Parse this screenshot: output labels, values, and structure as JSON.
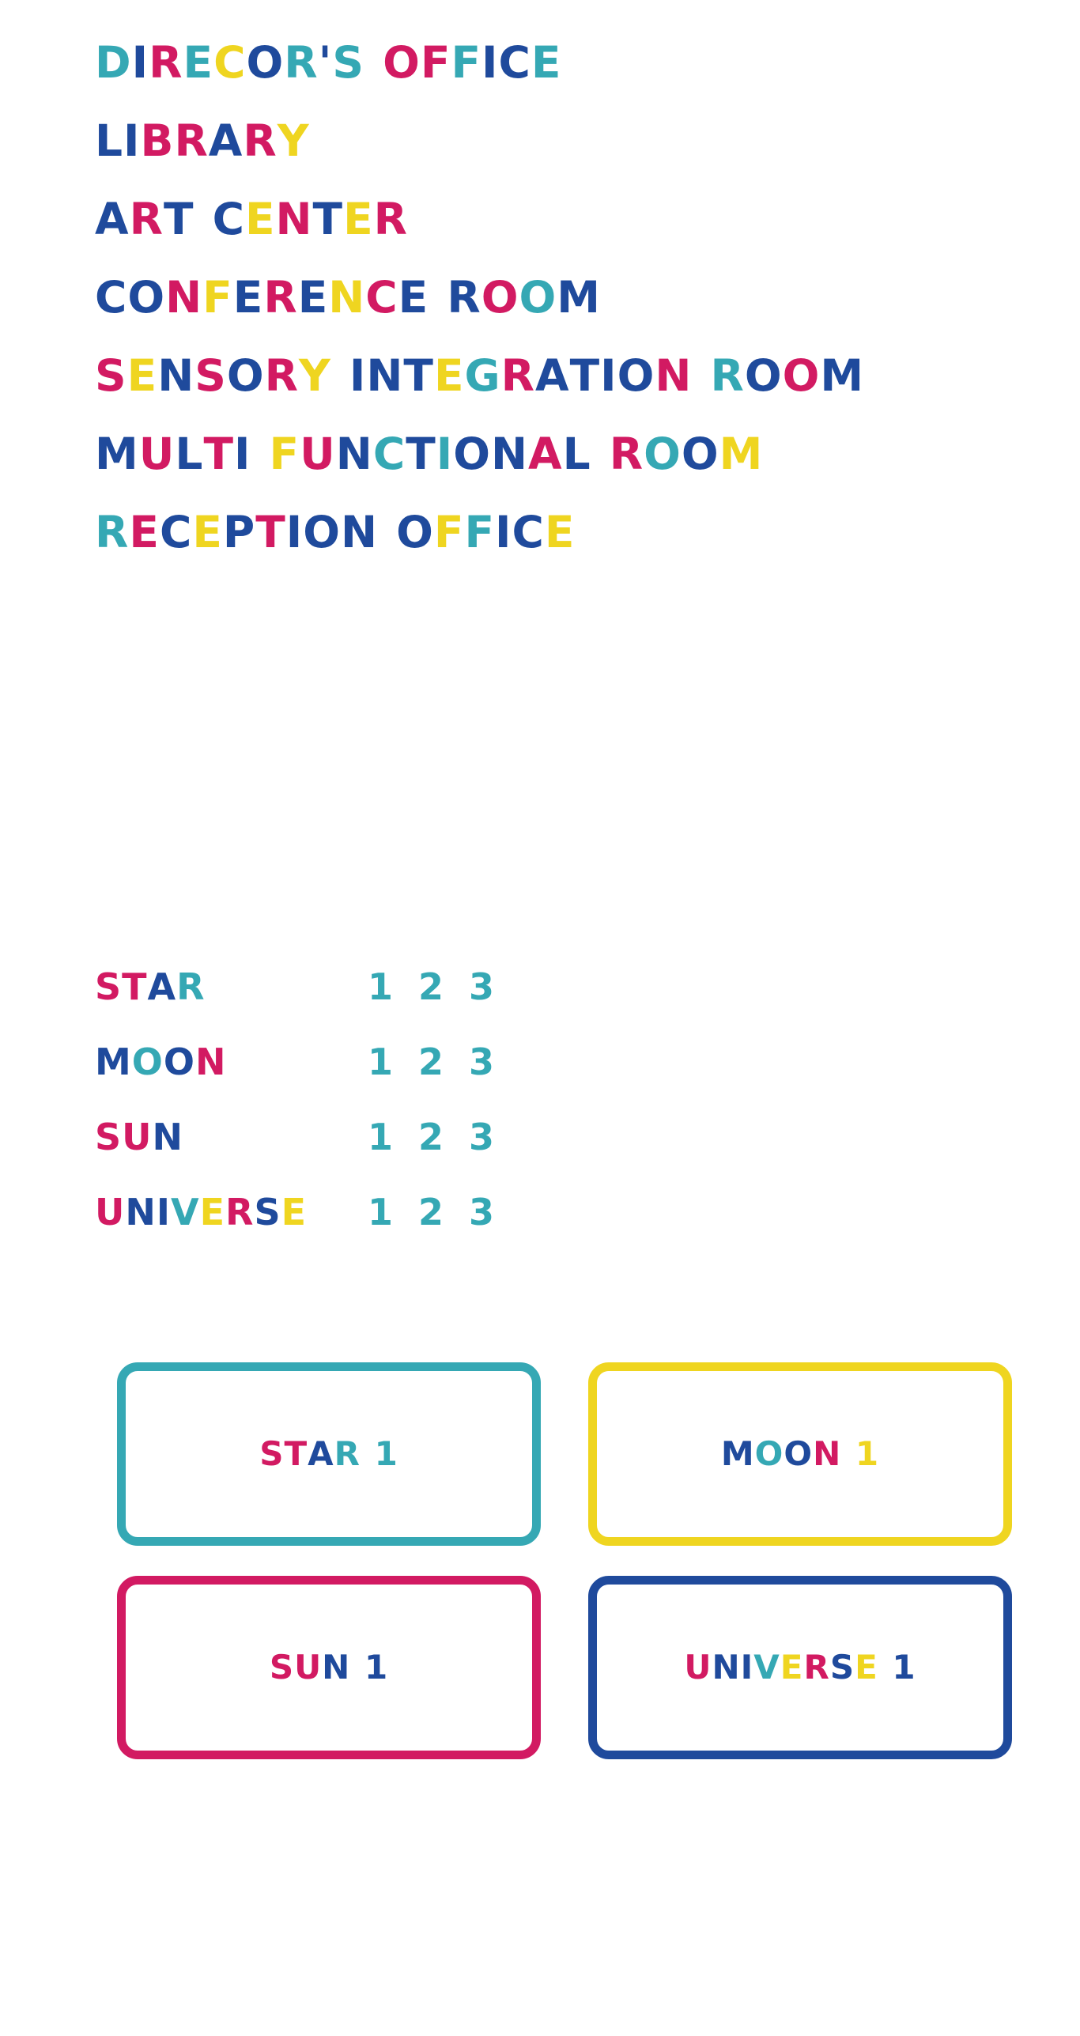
{
  "palette": {
    "navy": "#1f4a9c",
    "teal": "#35a8b4",
    "pink": "#d21a62",
    "yellow": "#efd520",
    "background": "#ffffff"
  },
  "rooms": [
    {
      "label": "DIRECOR'S OFFICE",
      "colors": [
        "teal",
        "navy",
        "pink",
        "teal",
        "yellow",
        "navy",
        "teal",
        "navy",
        "teal",
        "pink",
        "pink",
        "sp",
        "teal",
        "navy",
        "navy",
        "teal",
        "navy",
        "navy"
      ]
    },
    {
      "label": "LIBRARY",
      "colors": [
        "navy",
        "navy",
        "pink",
        "pink",
        "navy",
        "pink",
        "yellow"
      ]
    },
    {
      "label": "ART CENTER",
      "colors": [
        "navy",
        "pink",
        "navy",
        "sp",
        "navy",
        "yellow",
        "pink",
        "navy",
        "yellow",
        "pink"
      ]
    },
    {
      "label": "CONFERENCE ROOM",
      "colors": [
        "navy",
        "navy",
        "pink",
        "yellow",
        "navy",
        "pink",
        "navy",
        "yellow",
        "pink",
        "navy",
        "navy",
        "sp",
        "pink",
        "teal",
        "navy",
        "navy"
      ]
    },
    {
      "label": "SENSORY INTEGRATION ROOM",
      "colors": [
        "pink",
        "yellow",
        "navy",
        "pink",
        "navy",
        "pink",
        "yellow",
        "sp",
        "navy",
        "navy",
        "navy",
        "yellow",
        "teal",
        "pink",
        "navy",
        "navy",
        "navy",
        "navy",
        "sp",
        "pink",
        "teal",
        "navy",
        "pink"
      ]
    },
    {
      "label": "MULTI FUNCTIONAL ROOM",
      "colors": [
        "navy",
        "pink",
        "navy",
        "pink",
        "navy",
        "sp",
        "yellow",
        "pink",
        "navy",
        "teal",
        "navy",
        "teal",
        "navy",
        "navy",
        "pink",
        "navy",
        "sp",
        "pink",
        "teal",
        "navy",
        "yellow"
      ]
    },
    {
      "label": "RECEPTION OFFICE",
      "colors": [
        "teal",
        "pink",
        "navy",
        "yellow",
        "navy",
        "pink",
        "navy",
        "navy",
        "navy",
        "sp",
        "navy",
        "yellow",
        "teal",
        "navy",
        "navy",
        "yellow"
      ]
    }
  ],
  "token_list": {
    "numbers": [
      "1",
      "2",
      "3"
    ],
    "number_colors": [
      "teal",
      "teal",
      "teal"
    ],
    "rows": [
      {
        "name": "STAR",
        "colors": [
          "pink",
          "pink",
          "navy",
          "teal"
        ],
        "numbers": [
          "1",
          "2",
          "3"
        ]
      },
      {
        "name": "MOON",
        "colors": [
          "navy",
          "teal",
          "navy",
          "pink"
        ],
        "numbers": [
          "1",
          "2",
          "3"
        ]
      },
      {
        "name": "SUN",
        "colors": [
          "pink",
          "pink",
          "navy"
        ],
        "numbers": [
          "1",
          "2",
          "3"
        ]
      },
      {
        "name": "UNIVERSE",
        "colors": [
          "pink",
          "navy",
          "navy",
          "teal",
          "yellow",
          "pink",
          "navy",
          "yellow"
        ],
        "numbers": [
          "1",
          "2",
          "3"
        ]
      }
    ]
  },
  "cards": [
    {
      "label": "STAR 1",
      "border": "teal",
      "colors": [
        "pink",
        "pink",
        "navy",
        "teal",
        "sp",
        "teal"
      ]
    },
    {
      "label": "MOON 1",
      "border": "yellow",
      "colors": [
        "navy",
        "teal",
        "navy",
        "pink",
        "sp",
        "yellow"
      ]
    },
    {
      "label": "SUN 1",
      "border": "pink",
      "colors": [
        "pink",
        "pink",
        "navy",
        "sp",
        "navy"
      ]
    },
    {
      "label": "UNIVERSE 1",
      "border": "navy",
      "colors": [
        "pink",
        "navy",
        "navy",
        "teal",
        "yellow",
        "pink",
        "navy",
        "yellow",
        "sp",
        "navy"
      ]
    }
  ]
}
